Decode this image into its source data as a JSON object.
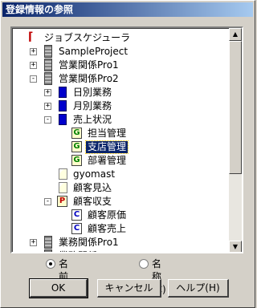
{
  "window": {
    "title": "登録情報の参照"
  },
  "tree": {
    "items": [
      {
        "label": "ジョブスケジューラ",
        "icon": "scheduler-icon",
        "expander": ""
      },
      {
        "label": "SampleProject",
        "icon": "server-icon",
        "expander": "+"
      },
      {
        "label": "営業関係Pro1",
        "icon": "server-icon",
        "expander": "+"
      },
      {
        "label": "営業関係Pro2",
        "icon": "server-icon",
        "expander": "−"
      },
      {
        "label": "日別業務",
        "icon": "folder-blue-icon",
        "expander": "+"
      },
      {
        "label": "月別業務",
        "icon": "folder-blue-icon",
        "expander": "+"
      },
      {
        "label": "売上状況",
        "icon": "folder-blue-icon",
        "expander": "−"
      },
      {
        "label": "担当管理",
        "icon": "g-badge-icon",
        "badge": "G",
        "expander": ""
      },
      {
        "label": "支店管理",
        "icon": "g-badge-icon",
        "badge": "G",
        "expander": "",
        "selected": true
      },
      {
        "label": "部署管理",
        "icon": "g-badge-icon",
        "badge": "G",
        "expander": ""
      },
      {
        "label": "gyomast",
        "icon": "doc-icon",
        "expander": ""
      },
      {
        "label": "顧客見込",
        "icon": "doc-icon",
        "expander": ""
      },
      {
        "label": "顧客収支",
        "icon": "p-badge-icon",
        "badge": "P",
        "expander": "−"
      },
      {
        "label": "顧客原価",
        "icon": "c-badge-icon",
        "badge": "C",
        "expander": ""
      },
      {
        "label": "顧客売上",
        "icon": "c-badge-icon",
        "badge": "C",
        "expander": ""
      },
      {
        "label": "業務関係Pro1",
        "icon": "server-icon",
        "expander": "+"
      },
      {
        "label": "業務関係Pro2",
        "icon": "server-icon",
        "expander": "+"
      }
    ]
  },
  "options": {
    "radio_name": "名前(N)",
    "radio_title": "名称(C)",
    "selected": "名前(N)"
  },
  "buttons": {
    "ok": "OK",
    "cancel": "キャンセル",
    "help": "ヘルプ(H)"
  },
  "colors": {
    "titlebar_start": "#0a246a",
    "titlebar_end": "#a6caf0",
    "selection": "#0a246a",
    "dialog_bg": "#d4d0c8"
  }
}
